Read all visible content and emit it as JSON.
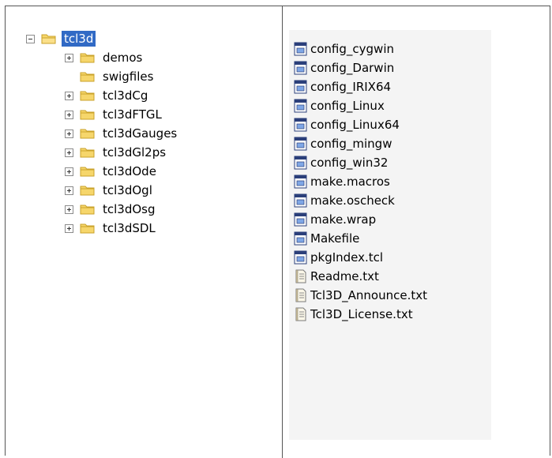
{
  "tree": {
    "root": {
      "label": "tcl3d",
      "expander": "minus",
      "selected": true
    },
    "children": [
      {
        "label": "demos",
        "expander": "plus"
      },
      {
        "label": "swigfiles",
        "expander": "none"
      },
      {
        "label": "tcl3dCg",
        "expander": "plus"
      },
      {
        "label": "tcl3dFTGL",
        "expander": "plus"
      },
      {
        "label": "tcl3dGauges",
        "expander": "plus"
      },
      {
        "label": "tcl3dGl2ps",
        "expander": "plus"
      },
      {
        "label": "tcl3dOde",
        "expander": "plus"
      },
      {
        "label": "tcl3dOgl",
        "expander": "plus"
      },
      {
        "label": "tcl3dOsg",
        "expander": "plus"
      },
      {
        "label": "tcl3dSDL",
        "expander": "plus"
      }
    ]
  },
  "files": [
    {
      "label": "config_cygwin",
      "icon": "makefile-icon"
    },
    {
      "label": "config_Darwin",
      "icon": "makefile-icon"
    },
    {
      "label": "config_IRIX64",
      "icon": "makefile-icon"
    },
    {
      "label": "config_Linux",
      "icon": "makefile-icon"
    },
    {
      "label": "config_Linux64",
      "icon": "makefile-icon"
    },
    {
      "label": "config_mingw",
      "icon": "makefile-icon"
    },
    {
      "label": "config_win32",
      "icon": "makefile-icon"
    },
    {
      "label": "make.macros",
      "icon": "makefile-icon"
    },
    {
      "label": "make.oscheck",
      "icon": "makefile-icon"
    },
    {
      "label": "make.wrap",
      "icon": "makefile-icon"
    },
    {
      "label": "Makefile",
      "icon": "makefile-icon"
    },
    {
      "label": "pkgIndex.tcl",
      "icon": "makefile-icon"
    },
    {
      "label": "Readme.txt",
      "icon": "text-file-icon"
    },
    {
      "label": "Tcl3D_Announce.txt",
      "icon": "text-file-icon"
    },
    {
      "label": "Tcl3D_License.txt",
      "icon": "text-file-icon"
    }
  ],
  "colors": {
    "selection": "#316ac5",
    "folder_fill": "#f6d66b",
    "folder_stroke": "#c9a22a",
    "pane_background": "#f4f4f4",
    "border": "#555555"
  }
}
